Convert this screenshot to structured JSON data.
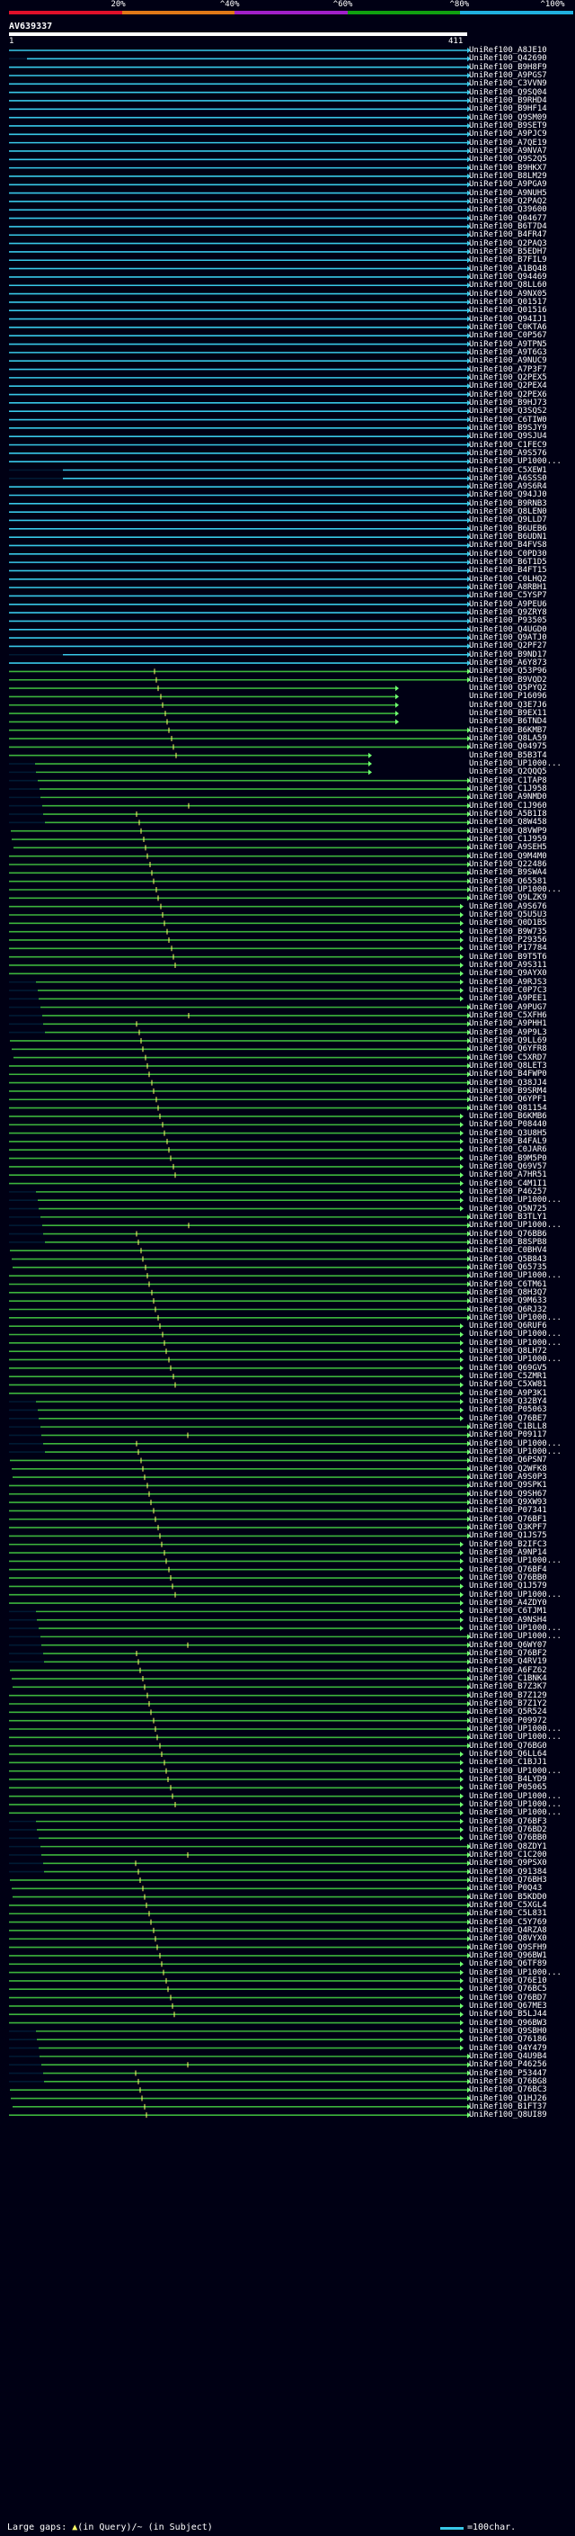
{
  "scale": {
    "labels": [
      "20%",
      "^40%",
      "^60%",
      "^80%",
      "^100%"
    ],
    "colors": [
      "#e0102a",
      "#e07818",
      "#a020c8",
      "#10a010",
      "#20b0e0"
    ]
  },
  "query": {
    "id": "AV639337",
    "start": "1",
    "end": "411"
  },
  "colors": {
    "cyan": "#38c8e8",
    "green": "#3cb43c",
    "gap_yellow": "#ffff66",
    "dark": "#001a33",
    "arrow": "#70ff70"
  },
  "hits": [
    "UniRef100_A8JE10",
    "UniRef100_Q42690",
    "UniRef100_B9H8F9",
    "UniRef100_A9PGS7",
    "UniRef100_C3VVN9",
    "UniRef100_Q9SQ04",
    "UniRef100_B9RHD4",
    "UniRef100_B9HF14",
    "UniRef100_Q9SM09",
    "UniRef100_B9SET9",
    "UniRef100_A9PJC9",
    "UniRef100_A7QE19",
    "UniRef100_A9NVA7",
    "UniRef100_Q9S2Q5",
    "UniRef100_B9HKX7",
    "UniRef100_B8LM29",
    "UniRef100_A9PGA9",
    "UniRef100_A9NUH5",
    "UniRef100_Q2PAQ2",
    "UniRef100_Q39600",
    "UniRef100_Q04677",
    "UniRef100_B6T7D4",
    "UniRef100_B4FR47",
    "UniRef100_Q2PAQ3",
    "UniRef100_B5EDH7",
    "UniRef100_B7FIL9",
    "UniRef100_A1BQ48",
    "UniRef100_Q94469",
    "UniRef100_Q8LL60",
    "UniRef100_A9NX05",
    "UniRef100_Q01517",
    "UniRef100_Q01516",
    "UniRef100_Q94IJ1",
    "UniRef100_C0KTA6",
    "UniRef100_C0P567",
    "UniRef100_A9TPN5",
    "UniRef100_A9T6G3",
    "UniRef100_A9NUC9",
    "UniRef100_A7P3F7",
    "UniRef100_Q2PEX5",
    "UniRef100_Q2PEX4",
    "UniRef100_Q2PEX6",
    "UniRef100_B9HJ73",
    "UniRef100_Q3SQS2",
    "UniRef100_C6TIW0",
    "UniRef100_B9SJY9",
    "UniRef100_Q9SJU4",
    "UniRef100_C1FEC9",
    "UniRef100_A9S576",
    "UniRef100_UP1000...",
    "UniRef100_C5XEW1",
    "UniRef100_A6SSS0",
    "UniRef100_A9S6R4",
    "UniRef100_Q94JJ0",
    "UniRef100_B9RNB3",
    "UniRef100_Q8LEN0",
    "UniRef100_Q9LLD7",
    "UniRef100_B6UEB6",
    "UniRef100_B6UDN1",
    "UniRef100_B4FVS8",
    "UniRef100_C0PD30",
    "UniRef100_B6T1D5",
    "UniRef100_B4FT15",
    "UniRef100_C0LHQ2",
    "UniRef100_A8RBH1",
    "UniRef100_C5YSP7",
    "UniRef100_A9PEU6",
    "UniRef100_Q9ZRY8",
    "UniRef100_P93505",
    "UniRef100_Q4UGD0",
    "UniRef100_Q9ATJ0",
    "UniRef100_Q2PF27",
    "UniRef100_B9ND17",
    "UniRef100_A6Y873",
    "UniRef100_Q53P96",
    "UniRef100_B9VQD2",
    "UniRef100_Q5PYQ2",
    "UniRef100_P16096",
    "UniRef100_Q3E7J6",
    "UniRef100_B9EX11",
    "UniRef100_B6TND4",
    "UniRef100_B6KMB7",
    "UniRef100_Q8LA59",
    "UniRef100_Q04975",
    "UniRef100_B5B3T4",
    "UniRef100_UP1000...",
    "UniRef100_Q2QQQ5",
    "UniRef100_C1TAP8",
    "UniRef100_C1J958",
    "UniRef100_A9NMD0",
    "UniRef100_C1J960",
    "UniRef100_A5B1I8",
    "UniRef100_Q8W458",
    "UniRef100_Q8VWP9",
    "UniRef100_C1J959",
    "UniRef100_A9SEH5",
    "UniRef100_Q9M4M0",
    "UniRef100_Q22486",
    "UniRef100_B9SWA4",
    "UniRef100_Q65581",
    "UniRef100_UP1000...",
    "UniRef100_Q9LZK9",
    "UniRef100_A9S676",
    "UniRef100_Q5U5U3",
    "UniRef100_Q0D1B5",
    "UniRef100_B9W735",
    "UniRef100_P29356",
    "UniRef100_P17784",
    "UniRef100_B9T5T6",
    "UniRef100_A9S311",
    "UniRef100_Q9AYX0",
    "UniRef100_A9RJS3",
    "UniRef100_C0P7C3",
    "UniRef100_A9PEE1",
    "UniRef100_A9PUG7",
    "UniRef100_C5XFH6",
    "UniRef100_A9PHH1",
    "UniRef100_A9P9L3",
    "UniRef100_Q9LL69",
    "UniRef100_Q6YFR8",
    "UniRef100_C5XRD7",
    "UniRef100_Q8LET3",
    "UniRef100_B4FWP0",
    "UniRef100_Q38JJ4",
    "UniRef100_B9SRM4",
    "UniRef100_Q6YPF1",
    "UniRef100_Q81154",
    "UniRef100_B6KMB6",
    "UniRef100_P08440",
    "UniRef100_Q3U8H5",
    "UniRef100_B4FAL9",
    "UniRef100_C0JAR6",
    "UniRef100_B9M5P0",
    "UniRef100_Q69V57",
    "UniRef100_A7HR51",
    "UniRef100_C4M1I1",
    "UniRef100_P46257",
    "UniRef100_UP1000...",
    "UniRef100_Q5N725",
    "UniRef100_B3TLY1",
    "UniRef100_UP1000...",
    "UniRef100_Q76BB6",
    "UniRef100_B8SPB8",
    "UniRef100_C0BHV4",
    "UniRef100_Q5B843",
    "UniRef100_Q65735",
    "UniRef100_UP1000...",
    "UniRef100_C6TM61",
    "UniRef100_Q8H3Q7",
    "UniRef100_Q9M633",
    "UniRef100_Q6RJ32",
    "UniRef100_UP1000...",
    "UniRef100_Q6RUF6",
    "UniRef100_UP1000...",
    "UniRef100_UP1000...",
    "UniRef100_Q8LH72",
    "UniRef100_UP1000...",
    "UniRef100_Q69GV5",
    "UniRef100_C5ZMR1",
    "UniRef100_C5XW81",
    "UniRef100_A9P3K1",
    "UniRef100_Q32BY4",
    "UniRef100_P05063",
    "UniRef100_Q76BE7",
    "UniRef100_C1BLL8",
    "UniRef100_P09117",
    "UniRef100_UP1000...",
    "UniRef100_UP1000...",
    "UniRef100_Q6PSN7",
    "UniRef100_Q2WFK8",
    "UniRef100_A9S0P3",
    "UniRef100_Q9SPK1",
    "UniRef100_Q9SH67",
    "UniRef100_Q9XW93",
    "UniRef100_P07341",
    "UniRef100_Q76BF1",
    "UniRef100_Q3KPF7",
    "UniRef100_Q1JS75",
    "UniRef100_B2IFC3",
    "UniRef100_A9NP14",
    "UniRef100_UP1000...",
    "UniRef100_Q76BF4",
    "UniRef100_Q76BB0",
    "UniRef100_Q1J579",
    "UniRef100_UP1000...",
    "UniRef100_A4ZDY0",
    "UniRef100_C6TJM1",
    "UniRef100_A9NSH4",
    "UniRef100_UP1000...",
    "UniRef100_UP1000...",
    "UniRef100_Q6WY07",
    "UniRef100_Q76BF2",
    "UniRef100_Q4RV19",
    "UniRef100_A6FZ62",
    "UniRef100_C1BNK4",
    "UniRef100_B7Z3K7",
    "UniRef100_B7Z129",
    "UniRef100_B7Z1Y2",
    "UniRef100_Q5R524",
    "UniRef100_P09972",
    "UniRef100_UP1000...",
    "UniRef100_UP1000...",
    "UniRef100_Q76BG0",
    "UniRef100_Q6LL64",
    "UniRef100_C1BJJ1",
    "UniRef100_UP1000...",
    "UniRef100_B4LYD9",
    "UniRef100_P05065",
    "UniRef100_UP1000...",
    "UniRef100_UP1000...",
    "UniRef100_UP1000...",
    "UniRef100_Q76BF3",
    "UniRef100_Q76BD2",
    "UniRef100_Q76BB0",
    "UniRef100_Q8ZDY1",
    "UniRef100_C1C200",
    "UniRef100_Q9PSX0",
    "UniRef100_Q91384",
    "UniRef100_Q76BH3",
    "UniRef100_P0Q43",
    "UniRef100_B5KDD0",
    "UniRef100_C5XGL4",
    "UniRef100_C5L831",
    "UniRef100_C5Y769",
    "UniRef100_Q4RZA8",
    "UniRef100_Q8VYX0",
    "UniRef100_Q9SFH9",
    "UniRef100_Q96BW1",
    "UniRef100_Q6TF89",
    "UniRef100_UP1000...",
    "UniRef100_Q76E10",
    "UniRef100_Q76BC5",
    "UniRef100_Q76BD7",
    "UniRef100_Q67ME3",
    "UniRef100_B5LJ44",
    "UniRef100_Q96BW3",
    "UniRef100_Q9SBH0",
    "UniRef100_Q76186",
    "UniRef100_Q4Y479",
    "UniRef100_Q4U9B4",
    "UniRef100_P46256",
    "UniRef100_P53447",
    "UniRef100_Q76BG8",
    "UniRef100_Q76BC3",
    "UniRef100_Q1HJ26",
    "UniRef100_B1FT37",
    "UniRef100_Q8UI89"
  ],
  "footer": {
    "large_gaps_label": "Large gaps:",
    "in_query": "(in Query)",
    "in_subject": "/~ (in Subject)",
    "scale_label": "=100char."
  }
}
